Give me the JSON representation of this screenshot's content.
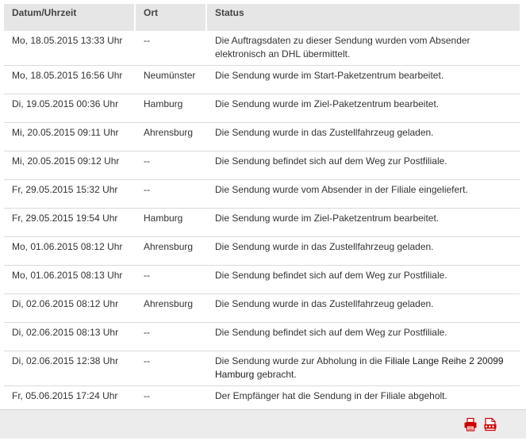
{
  "table": {
    "headers": {
      "datetime": "Datum/Uhrzeit",
      "location": "Ort",
      "status": "Status"
    },
    "rows": [
      {
        "datetime": "Mo, 18.05.2015 13:33 Uhr",
        "location": "--",
        "status": "Die Auftragsdaten zu dieser Sendung wurden vom Absender elektronisch an DHL übermittelt."
      },
      {
        "datetime": "Mo, 18.05.2015 16:56 Uhr",
        "location": "Neumünster",
        "status": "Die Sendung wurde im Start-Paketzentrum bearbeitet."
      },
      {
        "datetime": "Di, 19.05.2015 00:36 Uhr",
        "location": "Hamburg",
        "status": "Die Sendung wurde im Ziel-Paketzentrum bearbeitet."
      },
      {
        "datetime": "Mi, 20.05.2015 09:11 Uhr",
        "location": "Ahrensburg",
        "status": "Die Sendung wurde in das Zustellfahrzeug geladen."
      },
      {
        "datetime": "Mi, 20.05.2015 09:12 Uhr",
        "location": "--",
        "status": "Die Sendung befindet sich auf dem Weg zur Postfiliale."
      },
      {
        "datetime": "Fr, 29.05.2015 15:32 Uhr",
        "location": "--",
        "status": "Die Sendung wurde vom Absender in der Filiale eingeliefert."
      },
      {
        "datetime": "Fr, 29.05.2015 19:54 Uhr",
        "location": "Hamburg",
        "status": "Die Sendung wurde im Ziel-Paketzentrum bearbeitet."
      },
      {
        "datetime": "Mo, 01.06.2015 08:12 Uhr",
        "location": "Ahrensburg",
        "status": "Die Sendung wurde in das Zustellfahrzeug geladen."
      },
      {
        "datetime": "Mo, 01.06.2015 08:13 Uhr",
        "location": "--",
        "status": "Die Sendung befindet sich auf dem Weg zur Postfiliale."
      },
      {
        "datetime": "Di, 02.06.2015 08:12 Uhr",
        "location": "Ahrensburg",
        "status": "Die Sendung wurde in das Zustellfahrzeug geladen."
      },
      {
        "datetime": "Di, 02.06.2015 08:13 Uhr",
        "location": "--",
        "status": "Die Sendung befindet sich auf dem Weg zur Postfiliale."
      },
      {
        "datetime": "Di, 02.06.2015 12:38 Uhr",
        "location": "--",
        "status_pre": "Die Sendung wurde zur Abholung in die ",
        "status_link": "Filiale Lange Reihe 2 20099 Hamburg",
        "status_post": " gebracht."
      },
      {
        "datetime": "Fr, 05.06.2015 17:24 Uhr",
        "location": "--",
        "status": "Der Empfänger hat die Sendung in der Filiale abgeholt."
      }
    ]
  },
  "footer": {
    "icons": [
      "print-icon",
      "pdf-icon"
    ],
    "accent_color": "#cc0000"
  }
}
